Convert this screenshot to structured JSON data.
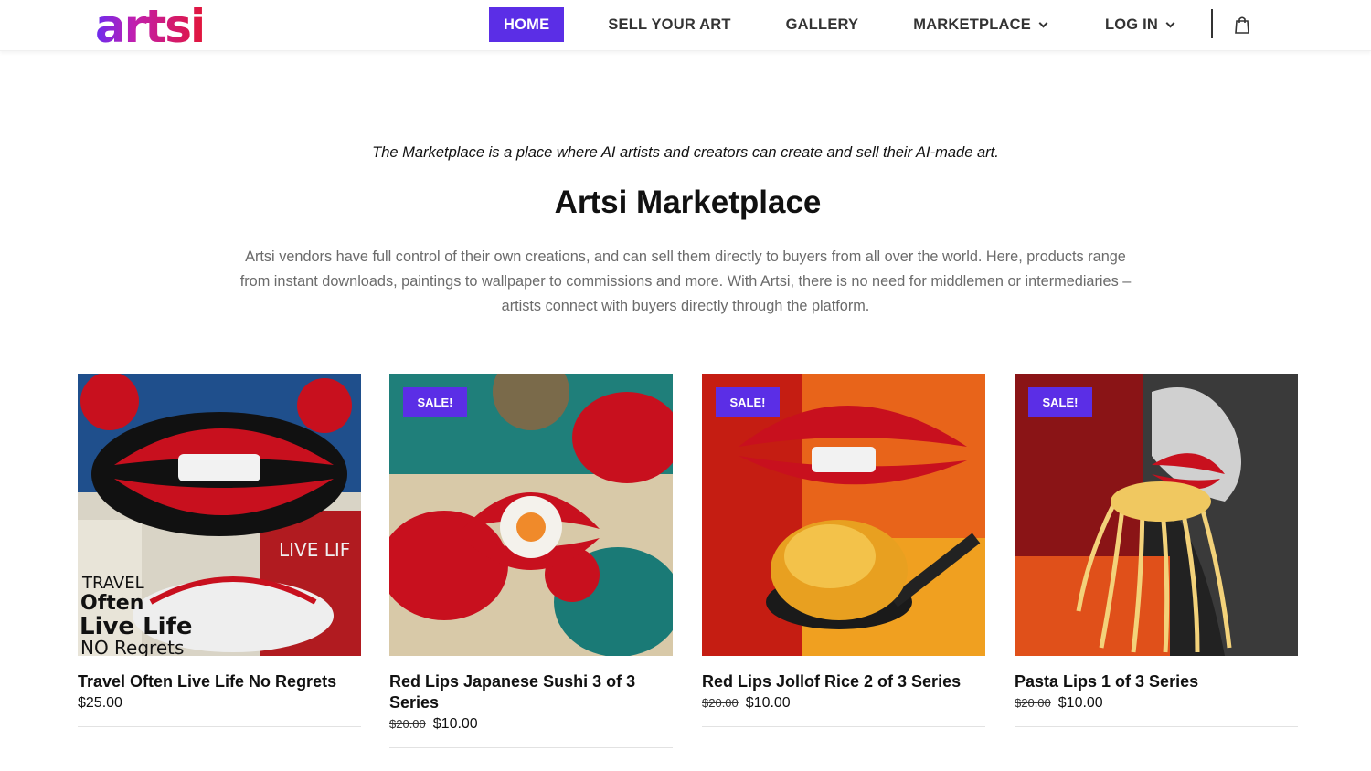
{
  "header": {
    "logo_text": "artsi",
    "nav": {
      "home": "HOME",
      "sell": "SELL YOUR ART",
      "gallery": "GALLERY",
      "marketplace": "MARKETPLACE",
      "login": "LOG IN"
    },
    "cart_icon": "shopping-bag-icon"
  },
  "intro": {
    "tagline": "The Marketplace is a place where AI artists and creators can create and sell their AI-made art.",
    "title": "Artsi Marketplace",
    "description": "Artsi vendors have full control of their own creations, and can sell them directly to buyers from all over the world. Here, products range from instant downloads, paintings to wallpaper to commissions and more. With Artsi, there is no need for middlemen or intermediaries – artists connect with buyers directly through the platform."
  },
  "products": [
    {
      "name": "Travel Often Live Life No Regrets",
      "old_price": "",
      "price": "$25.00",
      "sale": ""
    },
    {
      "name": "Red Lips Japanese Sushi 3 of 3 Series",
      "old_price": "$20.00",
      "price": "$10.00",
      "sale": "SALE!"
    },
    {
      "name": "Red Lips Jollof Rice 2 of 3 Series",
      "old_price": "$20.00",
      "price": "$10.00",
      "sale": "SALE!"
    },
    {
      "name": "Pasta Lips 1 of 3 Series",
      "old_price": "$20.00",
      "price": "$10.00",
      "sale": "SALE!"
    }
  ],
  "colors": {
    "accent": "#5b2ee6",
    "lip_red": "#c8101e"
  }
}
